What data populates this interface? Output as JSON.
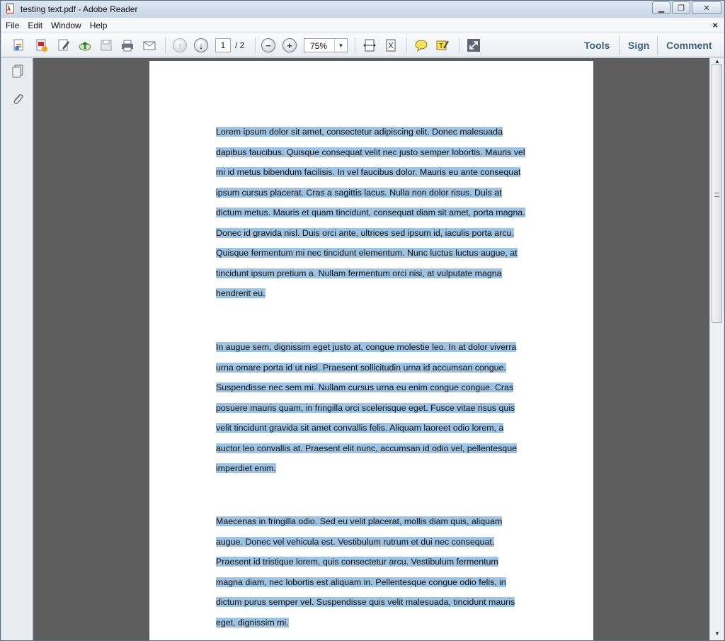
{
  "window": {
    "title": "testing text.pdf - Adobe Reader"
  },
  "menu": {
    "items": [
      "File",
      "Edit",
      "Window",
      "Help"
    ]
  },
  "toolbar": {
    "page_current": "1",
    "page_total": "/ 2",
    "zoom": "75%",
    "tools_label": "Tools",
    "sign_label": "Sign",
    "comment_label": "Comment"
  },
  "document": {
    "paragraphs": [
      "Lorem ipsum dolor sit amet, consectetur adipiscing elit. Donec malesuada dapibus faucibus. Quisque consequat velit nec justo semper lobortis. Mauris vel mi id metus bibendum facilisis. In vel faucibus dolor. Mauris eu ante consequat ipsum cursus placerat. Cras a sagittis lacus. Nulla non dolor risus. Duis at dictum metus. Mauris et quam tincidunt, consequat diam sit amet, porta magna. Donec id gravida nisl. Duis orci ante, ultrices sed ipsum id, iaculis porta arcu. Quisque fermentum mi nec tincidunt elementum. Nunc luctus luctus augue, at tincidunt ipsum pretium a. Nullam fermentum orci nisi, at vulputate magna hendrerit eu.",
      "In augue sem, dignissim eget justo at, congue molestie leo. In at dolor viverra urna omare porta id ut nisl. Praesent sollicitudin urna id accumsan congue. Suspendisse nec sem mi. Nullam cursus urna eu enim congue congue. Cras posuere mauris quam, in fringilla orci scelerisque eget. Fusce vitae risus quis velit tincidunt gravida sit amet convallis felis. Aliquam laoreet odio lorem, a auctor leo convallis at. Praesent elit nunc, accumsan id odio vel, pellentesque imperdiet enim.",
      "Maecenas in fringilla odio. Sed eu velit placerat, mollis diam quis, aliquam augue. Donec vel vehicula est. Vestibulum rutrum et dui nec consequat. Praesent id tristique lorem, quis consectetur arcu. Vestibulum fermentum magna diam, nec lobortis est aliquam in. Pellentesque congue odio felis, in dictum purus semper vel. Suspendisse quis velit malesuada, tincidunt mauris eget, dignissim mi."
    ]
  },
  "colors": {
    "highlight": "#9fc3e3",
    "doc_background": "#5d5d5d",
    "right_buttons": "#3f5f7f"
  }
}
